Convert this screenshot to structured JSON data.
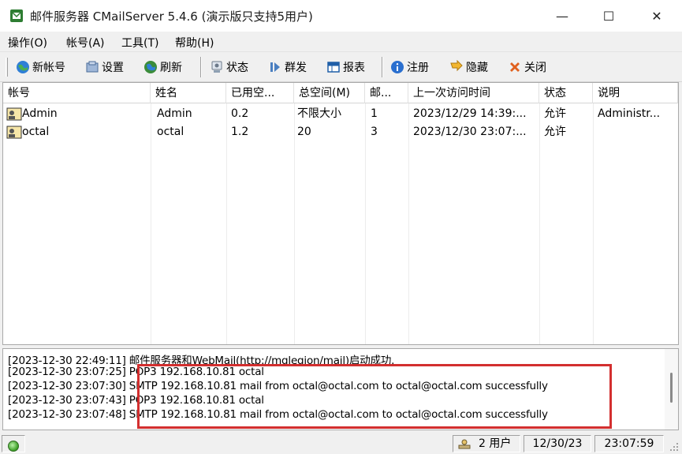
{
  "window": {
    "title": "邮件服务器 CMailServer 5.4.6 (演示版只支持5用户)",
    "min_glyph": "—",
    "max_glyph": "☐",
    "close_glyph": "✕"
  },
  "menu": [
    {
      "label": "操作(O)"
    },
    {
      "label": "帐号(A)"
    },
    {
      "label": "工具(T)"
    },
    {
      "label": "帮助(H)"
    }
  ],
  "toolbar": [
    {
      "label": "新帐号",
      "icon": "globe-icon"
    },
    {
      "label": "设置",
      "icon": "settings-box-icon"
    },
    {
      "label": "刷新",
      "icon": "refresh-globe-icon"
    },
    {
      "label": "状态",
      "icon": "status-icon"
    },
    {
      "label": "群发",
      "icon": "broadcast-icon"
    },
    {
      "label": "报表",
      "icon": "report-icon"
    },
    {
      "label": "注册",
      "icon": "info-icon"
    },
    {
      "label": "隐藏",
      "icon": "hide-arrow-icon"
    },
    {
      "label": "关闭",
      "icon": "close-x-icon"
    }
  ],
  "accounts": {
    "columns": [
      "帐号",
      "姓名",
      "已用空...",
      "总空间(M)",
      "邮...",
      "上一次访问时间",
      "状态",
      "说明"
    ],
    "rows": [
      {
        "account": "Admin",
        "name": "Admin",
        "used": "0.2",
        "total": "不限大小",
        "mails": "1",
        "last_access": "2023/12/29 14:39:...",
        "status": "允许",
        "desc": "Administr..."
      },
      {
        "account": "octal",
        "name": "octal",
        "used": "1.2",
        "total": "20",
        "mails": "3",
        "last_access": "2023/12/30 23:07:...",
        "status": "允许",
        "desc": ""
      }
    ]
  },
  "log": [
    "[2023-12-30 22:49:11] 邮件服务器和WebMail(http://mglegion/mail)启动成功.",
    "[2023-12-30 23:07:25] POP3 192.168.10.81 octal",
    "[2023-12-30 23:07:30] SMTP 192.168.10.81 mail from octal@octal.com to octal@octal.com successfully",
    "[2023-12-30 23:07:43] POP3 192.168.10.81 octal",
    "[2023-12-30 23:07:48] SMTP 192.168.10.81 mail from octal@octal.com to octal@octal.com successfully"
  ],
  "status": {
    "users": "2 用户",
    "date": "12/30/23",
    "time": "23:07:59"
  },
  "colors": {
    "highlight": "#d32f2f",
    "background": "#f0f0f0"
  }
}
